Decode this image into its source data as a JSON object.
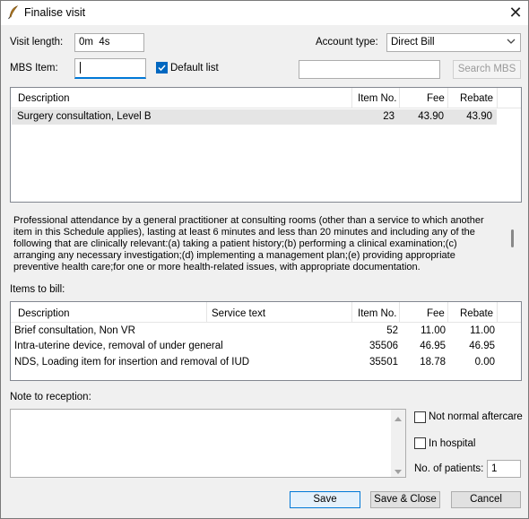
{
  "window": {
    "title": "Finalise visit"
  },
  "visit_length": {
    "label": "Visit length:",
    "value": "0m  4s"
  },
  "account_type": {
    "label": "Account type:",
    "value": "Direct Bill"
  },
  "mbs_item": {
    "label": "MBS Item:",
    "value": ""
  },
  "default_list": {
    "label": "Default list",
    "checked": true
  },
  "search_mbs": {
    "value": "",
    "button_label": "Search MBS"
  },
  "mbs_table": {
    "columns": [
      "Description",
      "Item No.",
      "Fee",
      "Rebate"
    ],
    "rows": [
      {
        "description": "Surgery consultation, Level B",
        "item_no": "23",
        "fee": "43.90",
        "rebate": "43.90"
      }
    ]
  },
  "item_description": "Professional attendance by a general practitioner at consulting rooms (other than a service to which another item in this Schedule applies), lasting at least 6 minutes and less than 20 minutes and including any of the following that are clinically relevant:(a) taking a patient history;(b) performing a clinical examination;(c) arranging any necessary investigation;(d) implementing a management plan;(e) providing appropriate preventive health care;for one or more health-related issues, with appropriate documentation.",
  "items_to_bill": {
    "label": "Items to bill:",
    "columns": [
      "Description",
      "Service text",
      "Item No.",
      "Fee",
      "Rebate"
    ],
    "rows": [
      {
        "description": "Brief consultation, Non VR",
        "service_text": "",
        "item_no": "52",
        "fee": "11.00",
        "rebate": "11.00"
      },
      {
        "description": "Intra-uterine device, removal of under general",
        "service_text": "",
        "item_no": "35506",
        "fee": "46.95",
        "rebate": "46.95"
      },
      {
        "description": "NDS, Loading item for insertion and removal of IUD",
        "service_text": "",
        "item_no": "35501",
        "fee": "18.78",
        "rebate": "0.00"
      }
    ]
  },
  "note_to_reception": {
    "label": "Note to reception:",
    "value": ""
  },
  "not_normal_aftercare": {
    "label": "Not normal aftercare",
    "checked": false
  },
  "in_hospital": {
    "label": "In hospital",
    "checked": false
  },
  "no_of_patients": {
    "label": "No. of patients:",
    "value": "1"
  },
  "buttons": {
    "save": "Save",
    "save_close": "Save & Close",
    "cancel": "Cancel"
  },
  "colors": {
    "accent": "#0078d7",
    "selected_row": "#e5e5e5"
  }
}
